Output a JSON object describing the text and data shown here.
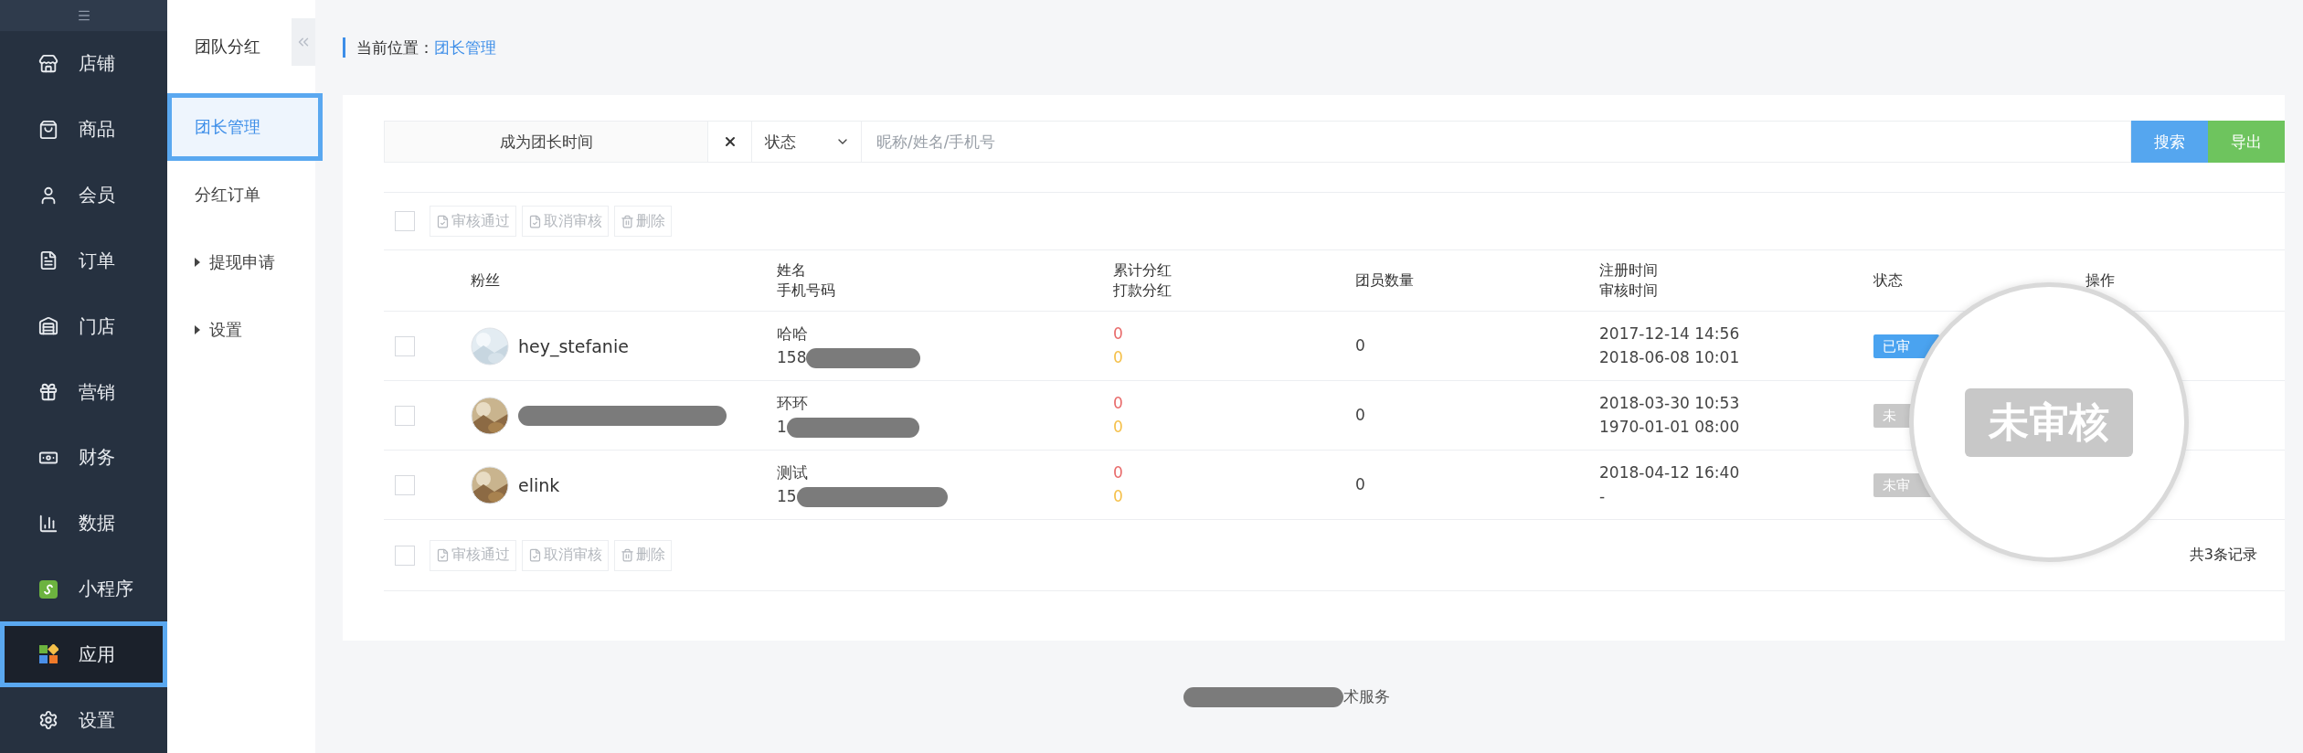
{
  "sidebar": {
    "items": [
      {
        "label": "店铺",
        "selected": false
      },
      {
        "label": "商品",
        "selected": false
      },
      {
        "label": "会员",
        "selected": false
      },
      {
        "label": "订单",
        "selected": false
      },
      {
        "label": "门店",
        "selected": false
      },
      {
        "label": "营销",
        "selected": false
      },
      {
        "label": "财务",
        "selected": false
      },
      {
        "label": "数据",
        "selected": false
      },
      {
        "label": "小程序",
        "selected": false
      },
      {
        "label": "应用",
        "selected": true
      },
      {
        "label": "设置",
        "selected": false
      }
    ]
  },
  "subnav": {
    "title": "团队分红",
    "items": [
      {
        "label": "团长管理",
        "selected": true,
        "expandable": false
      },
      {
        "label": "分红订单",
        "selected": false,
        "expandable": false
      },
      {
        "label": "提现申请",
        "selected": false,
        "expandable": true
      },
      {
        "label": "设置",
        "selected": false,
        "expandable": true
      }
    ]
  },
  "breadcrumb": {
    "label": "当前位置：",
    "current": "团长管理"
  },
  "filters": {
    "date_button": "成为团长时间",
    "status_select": "状态",
    "search": {
      "placeholder": "昵称/姓名/手机号"
    },
    "buttons": [
      {
        "label": "搜索",
        "kind": "primary"
      },
      {
        "label": "导出",
        "kind": "success"
      }
    ]
  },
  "bulk_actions": {
    "checked": false,
    "items": [
      {
        "label": "审核通过",
        "kind": "review"
      },
      {
        "label": "取消审核",
        "kind": "review"
      },
      {
        "label": "删除",
        "kind": "delete"
      }
    ]
  },
  "table": {
    "columns": [
      {
        "lines": [
          "粉丝"
        ]
      },
      {
        "lines": [
          "姓名",
          "手机号码"
        ]
      },
      {
        "lines": [
          "累计分红",
          "打款分红"
        ]
      },
      {
        "lines": [
          "团员数量"
        ]
      },
      {
        "lines": [
          "注册时间",
          "审核时间"
        ]
      },
      {
        "lines": [
          "状态"
        ]
      },
      {
        "lines": [
          "操作"
        ]
      }
    ],
    "rows": [
      {
        "checked": false,
        "fan": "hey_stefanie",
        "name": "哈哈",
        "phone": "158",
        "total": "0",
        "paid": "0",
        "members": "0",
        "registered": "2017-12-14 14:56",
        "reviewed": "2018-06-08 10:01",
        "status": {
          "label": "已审",
          "kind": "approved"
        }
      },
      {
        "checked": false,
        "name": "环环",
        "phone": "1",
        "total": "0",
        "paid": "0",
        "members": "0",
        "registered": "2018-03-30 10:53",
        "reviewed": "1970-01-01 08:00",
        "status": {
          "label": "未",
          "kind": "pending"
        }
      },
      {
        "checked": false,
        "fan": "elink",
        "name": "测试",
        "phone": "15",
        "total": "0",
        "paid": "0",
        "members": "0",
        "registered": "2018-04-12 16:40",
        "reviewed": "-",
        "status": {
          "label": "未审",
          "kind": "pending"
        }
      }
    ],
    "footer_actions": {
      "checked": false,
      "items": [
        {
          "label": "审核通过",
          "kind": "review"
        },
        {
          "label": "取消审核",
          "kind": "review"
        },
        {
          "label": "删除",
          "kind": "delete"
        }
      ]
    },
    "count": "共3条记录"
  },
  "magnifier": {
    "label": "未审核"
  },
  "footer": {
    "text": "术服务"
  }
}
